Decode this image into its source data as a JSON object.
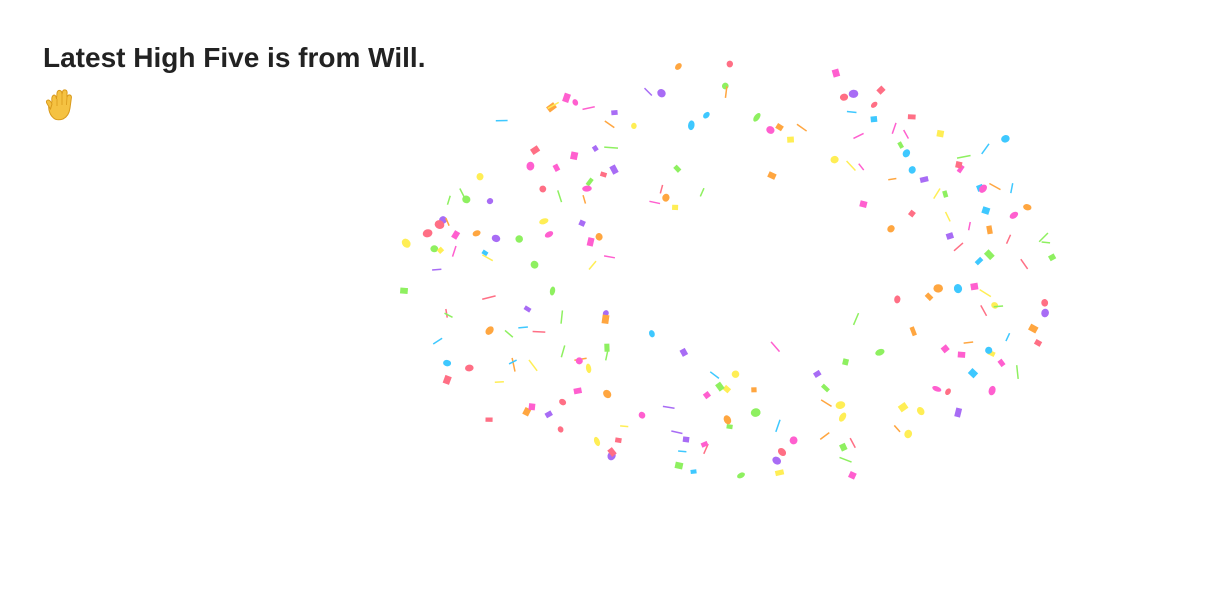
{
  "message": {
    "title": "Latest High Five is from Will."
  },
  "icons": {
    "hand": "raised-hand-icon"
  },
  "colors": {
    "text": "#222222",
    "background": "#ffffff",
    "hand": "#f5c242",
    "confetti": [
      "#ff5fcf",
      "#3ec8ff",
      "#ffa640",
      "#ff6f85",
      "#a86cf5",
      "#ffee55",
      "#8ef060"
    ]
  }
}
